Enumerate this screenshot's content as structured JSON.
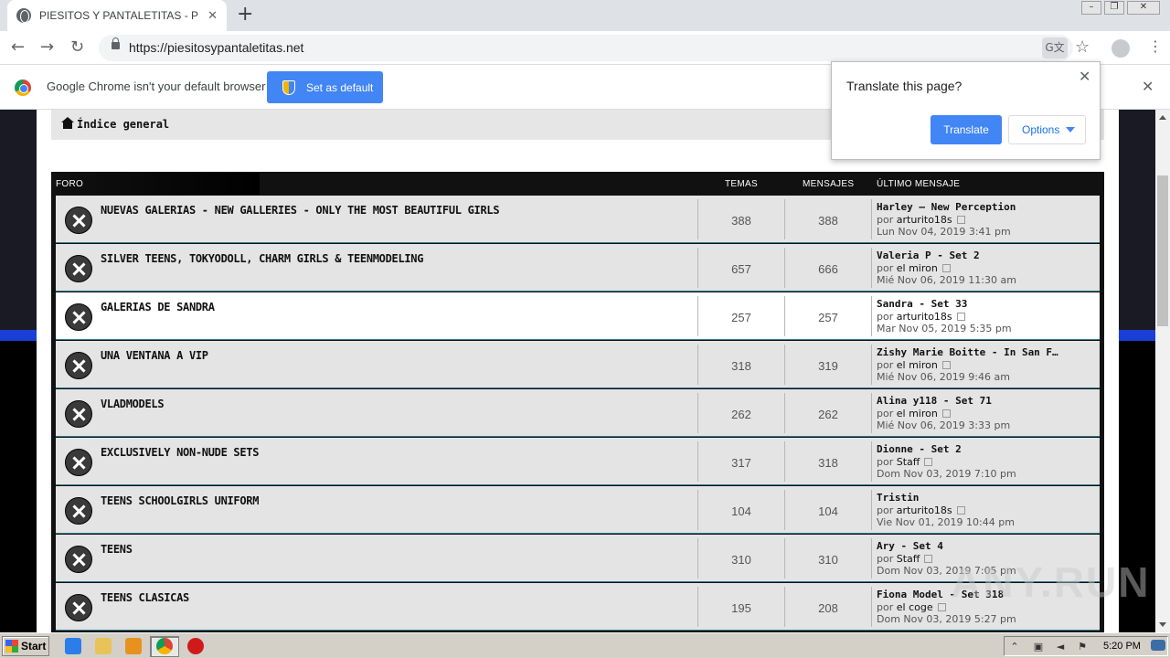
{
  "browser": {
    "tab_title": "PIESITOS Y PANTALETITAS - Página",
    "url": "https://piesitosypantaletitas.net",
    "infobar_text": "Google Chrome isn't your default browser",
    "set_default_label": "Set as default"
  },
  "translate_popup": {
    "title": "Translate this page?",
    "translate_label": "Translate",
    "options_label": "Options"
  },
  "page": {
    "breadcrumb": "Índice general",
    "headers": {
      "forum": "FORO",
      "topics": "TEMAS",
      "posts": "MENSAJES",
      "last_post": "ÚLTIMO MENSAJE"
    },
    "forums": [
      {
        "name": "NUEVAS GALERIAS - NEW GALLERIES - ONLY THE MOST BEAUTIFUL GIRLS",
        "topics": "388",
        "posts": "388",
        "last_title": "Harley – New Perception",
        "by_prefix": "por",
        "author": "arturito18s",
        "date": "Lun Nov 04, 2019 3:41 pm"
      },
      {
        "name": "SILVER TEENS, TOKYODOLL, CHARM GIRLS & TEENMODELING",
        "topics": "657",
        "posts": "666",
        "last_title": "Valeria P - Set 2",
        "by_prefix": "por",
        "author": "el miron",
        "date": "Mié Nov 06, 2019 11:30 am"
      },
      {
        "name": "GALERIAS DE SANDRA",
        "topics": "257",
        "posts": "257",
        "last_title": "Sandra - Set 33",
        "by_prefix": "por",
        "author": "arturito18s",
        "date": "Mar Nov 05, 2019 5:35 pm"
      },
      {
        "name": "UNA VENTANA A VIP",
        "topics": "318",
        "posts": "319",
        "last_title": "Zishy Marie Boitte - In San F…",
        "by_prefix": "por",
        "author": "el miron",
        "date": "Mié Nov 06, 2019 9:46 am"
      },
      {
        "name": "VLADMODELS",
        "topics": "262",
        "posts": "262",
        "last_title": "Alina y118 - Set 71",
        "by_prefix": "por",
        "author": "el miron",
        "date": "Mié Nov 06, 2019 3:33 pm"
      },
      {
        "name": "EXCLUSIVELY NON-NUDE SETS",
        "topics": "317",
        "posts": "318",
        "last_title": "Dionne - Set 2",
        "by_prefix": "por",
        "author": "Staff",
        "date": "Dom Nov 03, 2019 7:10 pm"
      },
      {
        "name": "TEENS SCHOOLGIRLS UNIFORM",
        "topics": "104",
        "posts": "104",
        "last_title": "Tristin",
        "by_prefix": "por",
        "author": "arturito18s",
        "date": "Vie Nov 01, 2019 10:44 pm"
      },
      {
        "name": "TEENS",
        "topics": "310",
        "posts": "310",
        "last_title": "Ary - Set 4",
        "by_prefix": "por",
        "author": "Staff",
        "date": "Dom Nov 03, 2019 7:05 pm"
      },
      {
        "name": "TEENS CLASICAS",
        "topics": "195",
        "posts": "208",
        "last_title": "Fiona Model - Set 318",
        "by_prefix": "por",
        "author": "el coge",
        "date": "Dom Nov 03, 2019 5:27 pm"
      }
    ]
  },
  "watermark": "ANY.RUN",
  "taskbar": {
    "start_label": "Start",
    "clock": "5:20 PM"
  }
}
